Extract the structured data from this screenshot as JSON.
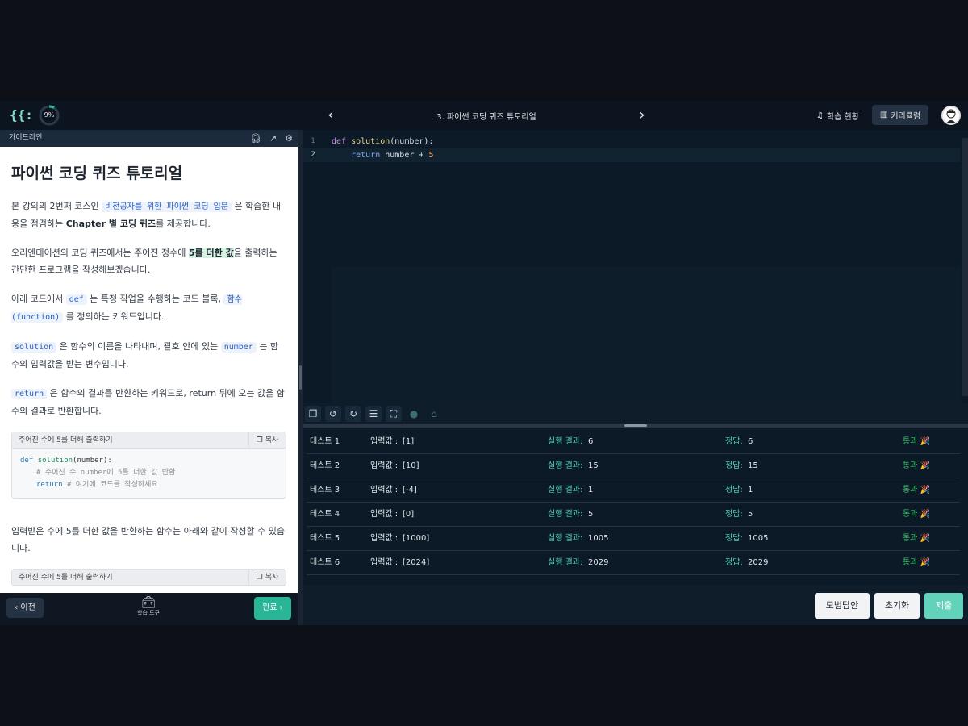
{
  "header": {
    "progress": "9%",
    "progress_value": 0.09,
    "lesson_title": "3. 파이썬 코딩 퀴즈 튜토리얼",
    "status_label": "학습 현황",
    "curriculum_label": "커리큘럼"
  },
  "guide": {
    "header_label": "가이드라인",
    "title": "파이썬 코딩 퀴즈 튜토리얼",
    "p1_a": "본 강의의 2번째 코스인",
    "p1_link": "비전공자를 위한 파이썬 코딩 입문",
    "p1_b": "은 학습한 내용을 점검하는",
    "p1_bold": "Chapter 별 코딩 퀴즈",
    "p1_c": "를 제공합니다.",
    "p2_a": "오리엔테이션의 코딩 퀴즈에서는 주어진 정수에",
    "p2_hl": "5를 더한 값",
    "p2_b": "을 출력하는 간단한 프로그램을 작성해보겠습니다.",
    "p3_a": "아래 코드에서",
    "p3_code1": "def",
    "p3_b": "는 특정 작업을 수행하는 코드 블록,",
    "p3_code2": "함수 (function)",
    "p3_c": "를 정의하는 키워드입니다.",
    "p4_code1": "solution",
    "p4_a": "은 함수의 이름을 나타내며, 괄호 안에 있는",
    "p4_code2": "number",
    "p4_b": "는 함수의 입력값을 받는 변수입니다.",
    "p5_code": "return",
    "p5_a": "은 함수의 결과를 반환하는 키워드로, return 뒤에 오는 값을 함수의 결과로 반환합니다.",
    "codebox_title": "주어진 수에 5를 더해 출력하기",
    "copy_label": "복사",
    "code_line1_kw": "def",
    "code_line1_fn": "solution",
    "code_line1_rest": "(number):",
    "code_line2": "# 주어진 수 number에 5를 더한 값 반환",
    "code_line3_kw": "return",
    "code_line3_cm": "# 여기에 코드를 작성하세요",
    "p6": "입력받은 수에 5를 더한 값을 반환하는 함수는 아래와 같이 작성할 수 있습니다.",
    "codebox2_title": "주어진 수에 5를 더해 출력하기",
    "copy_label2": "복사"
  },
  "footer": {
    "prev_label": "이전",
    "tools_label": "학습 도구",
    "done_label": "완료"
  },
  "editor": {
    "line1_no": "1",
    "line1_kw": "def",
    "line1_fn": "solution",
    "line1_rest": "(number):",
    "line2_no": "2",
    "line2_kw": "return",
    "line2_rest": " number + ",
    "line2_num": "5"
  },
  "results": {
    "input_label": "입력값 :",
    "run_label": "실행 결과:",
    "answer_label": "정답:",
    "rows": [
      {
        "name": "테스트 1",
        "input": "[1]",
        "run": "6",
        "answer": "6",
        "status": "통과 🎉"
      },
      {
        "name": "테스트 2",
        "input": "[10]",
        "run": "15",
        "answer": "15",
        "status": "통과 🎉"
      },
      {
        "name": "테스트 3",
        "input": "[-4]",
        "run": "1",
        "answer": "1",
        "status": "통과 🎉"
      },
      {
        "name": "테스트 4",
        "input": "[0]",
        "run": "5",
        "answer": "5",
        "status": "통과 🎉"
      },
      {
        "name": "테스트 5",
        "input": "[1000]",
        "run": "1005",
        "answer": "1005",
        "status": "통과 🎉"
      },
      {
        "name": "테스트 6",
        "input": "[2024]",
        "run": "2029",
        "answer": "2029",
        "status": "통과 🎉"
      }
    ]
  },
  "actions": {
    "model_answer": "모범답안",
    "reset": "초기화",
    "submit": "제출"
  },
  "colors": {
    "accent": "#2bb597",
    "pass": "#3ec46d",
    "background": "#0b1a26"
  }
}
